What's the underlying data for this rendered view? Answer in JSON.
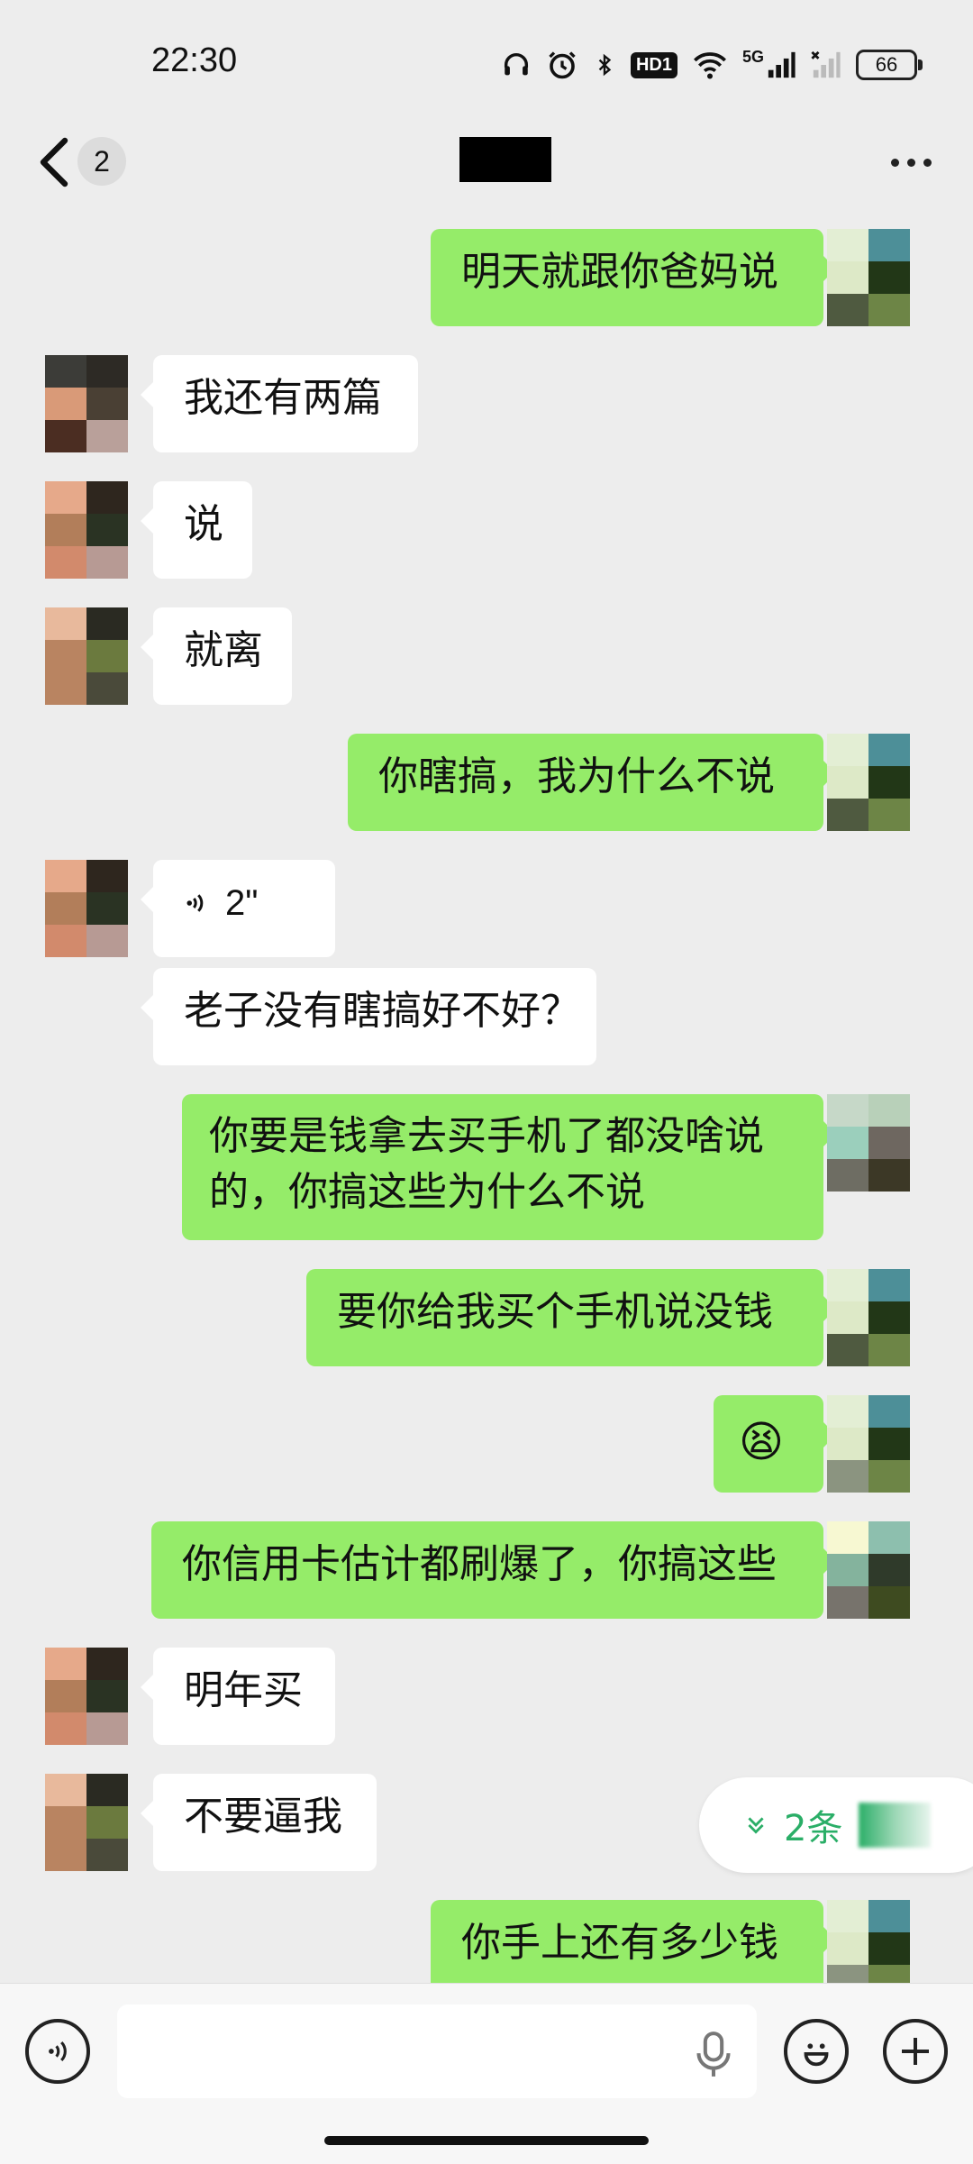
{
  "status_bar": {
    "time": "22:30",
    "hd_label": "HD1",
    "network_label": "5G",
    "battery": "66"
  },
  "nav": {
    "unread_count": "2"
  },
  "messages": [
    {
      "side": "me",
      "text": "明天就跟你爸妈说"
    },
    {
      "side": "them",
      "text": "我还有两篇"
    },
    {
      "side": "them",
      "text": "说"
    },
    {
      "side": "them",
      "text": "就离"
    },
    {
      "side": "me",
      "text": "你瞎搞，我为什么不说"
    },
    {
      "side": "them",
      "type": "voice",
      "text": "2\""
    },
    {
      "side": "them",
      "text": "老子没有瞎搞好不好？"
    },
    {
      "side": "me",
      "text": "你要是钱拿去买手机了都没啥说的，你搞这些为什么不说"
    },
    {
      "side": "me",
      "text": "要你给我买个手机说没钱"
    },
    {
      "side": "me",
      "type": "emoji",
      "text": "😫"
    },
    {
      "side": "me",
      "text": "你信用卡估计都刷爆了，你搞这些"
    },
    {
      "side": "them",
      "text": "明年买"
    },
    {
      "side": "them",
      "text": "不要逼我"
    },
    {
      "side": "me",
      "text": "你手上还有多少钱"
    }
  ],
  "new_messages_pill": {
    "label": "2条"
  },
  "colors": {
    "my_bubble": "#95ec69",
    "their_bubble": "#ffffff",
    "background": "#ededed",
    "pill_text": "#2aae67"
  }
}
